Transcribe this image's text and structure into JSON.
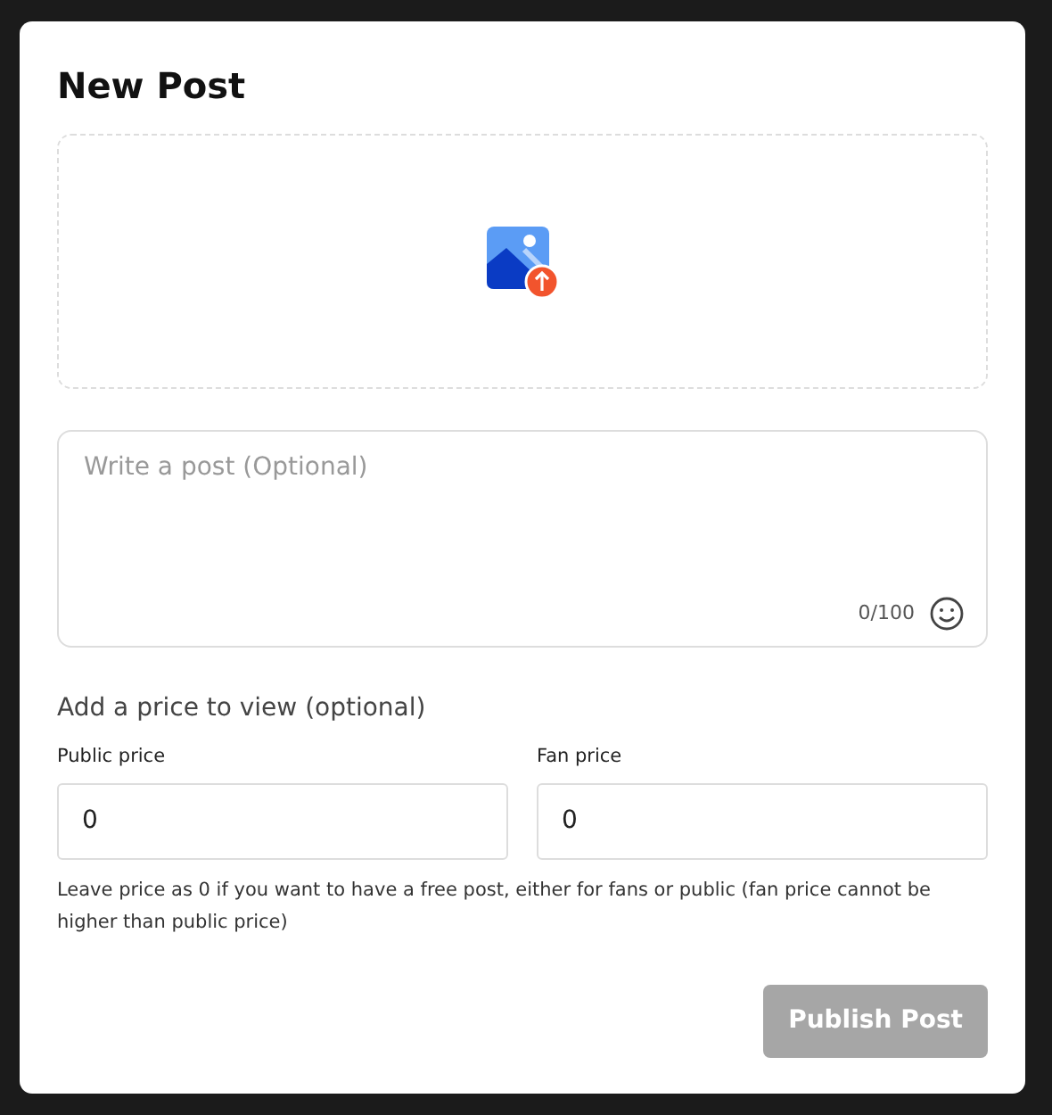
{
  "dialog": {
    "title": "New Post"
  },
  "post": {
    "placeholder": "Write a post (Optional)",
    "counter": "0/100"
  },
  "pricing": {
    "heading": "Add a price to view (optional)",
    "fields": [
      {
        "label": "Public price",
        "value": "0"
      },
      {
        "label": "Fan price",
        "value": "0"
      }
    ],
    "hint": "Leave price as 0 if you want to have a free post, either for fans or public (fan price cannot be higher than public price)"
  },
  "publish_button": {
    "label": "Publish Post",
    "disabled": true
  }
}
